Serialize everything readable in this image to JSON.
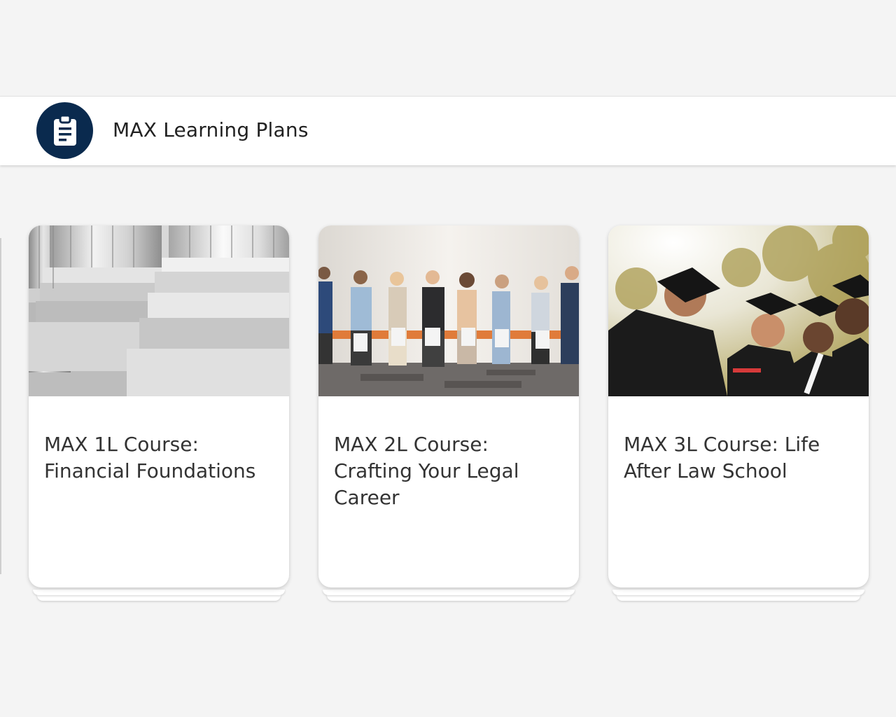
{
  "header": {
    "title": "MAX Learning Plans",
    "icon": "clipboard-icon",
    "icon_bg": "#0a2a4e"
  },
  "cards": [
    {
      "title": "MAX 1L Course: Financial Foundations",
      "image": "columns-photo"
    },
    {
      "title": "MAX 2L Course: Crafting Your Legal Career",
      "image": "job-candidates-photo"
    },
    {
      "title": "MAX 3L Course: Life After Law School",
      "image": "graduates-photo"
    }
  ]
}
